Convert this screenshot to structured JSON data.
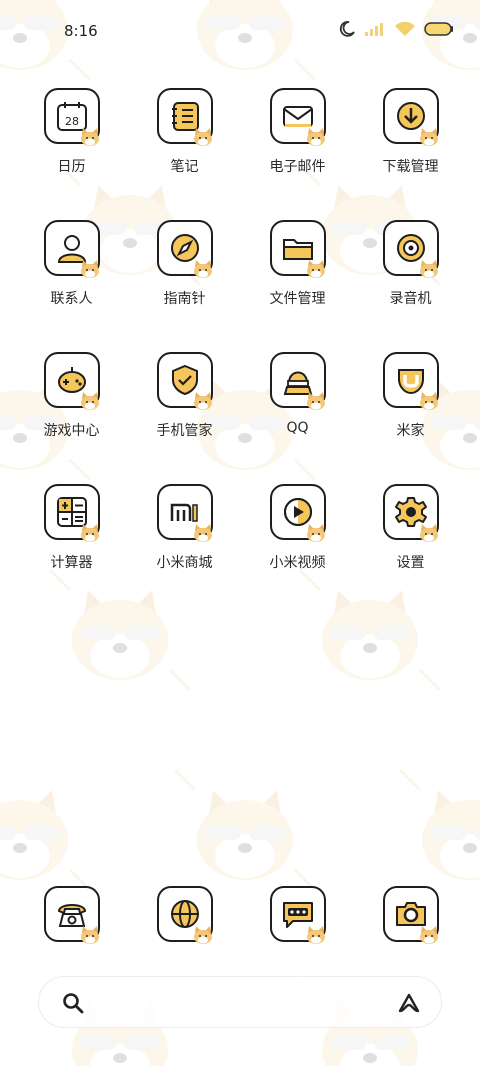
{
  "status_bar": {
    "time": "8:16",
    "icons": [
      "moon-icon",
      "signal-icon",
      "wifi-icon",
      "battery-icon"
    ]
  },
  "theme": {
    "accent": "#f5c75a",
    "stroke": "#1e1e1e",
    "wallpaper_tint": "#f7ead0"
  },
  "apps": [
    {
      "label": "日历",
      "icon": "calendar-icon",
      "calendar_date": "28"
    },
    {
      "label": "笔记",
      "icon": "notes-icon"
    },
    {
      "label": "电子邮件",
      "icon": "mail-icon"
    },
    {
      "label": "下载管理",
      "icon": "download-icon"
    },
    {
      "label": "联系人",
      "icon": "contacts-icon"
    },
    {
      "label": "指南针",
      "icon": "compass-icon"
    },
    {
      "label": "文件管理",
      "icon": "folder-icon"
    },
    {
      "label": "录音机",
      "icon": "recorder-icon"
    },
    {
      "label": "游戏中心",
      "icon": "gamepad-icon"
    },
    {
      "label": "手机管家",
      "icon": "shield-icon"
    },
    {
      "label": "QQ",
      "icon": "qq-icon"
    },
    {
      "label": "米家",
      "icon": "mijia-icon"
    },
    {
      "label": "计算器",
      "icon": "calculator-icon"
    },
    {
      "label": "小米商城",
      "icon": "mi-store-icon"
    },
    {
      "label": "小米视频",
      "icon": "video-play-icon"
    },
    {
      "label": "设置",
      "icon": "gear-icon"
    }
  ],
  "dock": [
    {
      "icon": "phone-icon"
    },
    {
      "icon": "browser-icon"
    },
    {
      "icon": "message-icon"
    },
    {
      "icon": "camera-icon"
    }
  ],
  "search_bar": {
    "left_icon": "search-icon",
    "right_icon": "assistant-icon"
  }
}
